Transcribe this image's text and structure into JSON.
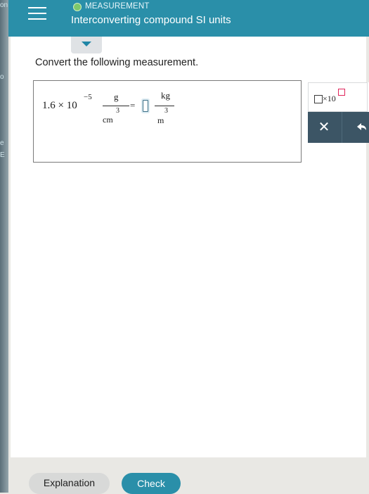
{
  "bezel": {
    "fragments": [
      "on",
      "o",
      "e",
      "E"
    ]
  },
  "header": {
    "topic": "MEASUREMENT",
    "title": "Interconverting compound SI units",
    "menu_icon": "hamburger-menu-icon",
    "status_color": "#7ec86b"
  },
  "collapse": {
    "icon": "chevron-down-icon"
  },
  "instruction": "Convert the following measurement.",
  "problem": {
    "coefficient": "1.6 × 10",
    "exponent": "−5",
    "given_num": "g",
    "given_den": "cm",
    "given_den_pow": "3",
    "equals": "=",
    "target_num": "kg",
    "target_den": "m",
    "target_den_pow": "3"
  },
  "tools": {
    "sci_label": "×10",
    "clear": "✕",
    "undo_icon": "undo-icon"
  },
  "buttons": {
    "explanation": "Explanation",
    "check": "Check"
  },
  "colors": {
    "header": "#2a8fa9",
    "check": "#2a8fa9",
    "tool_dark": "#3c5565",
    "exponent_box": "#e0245a"
  }
}
